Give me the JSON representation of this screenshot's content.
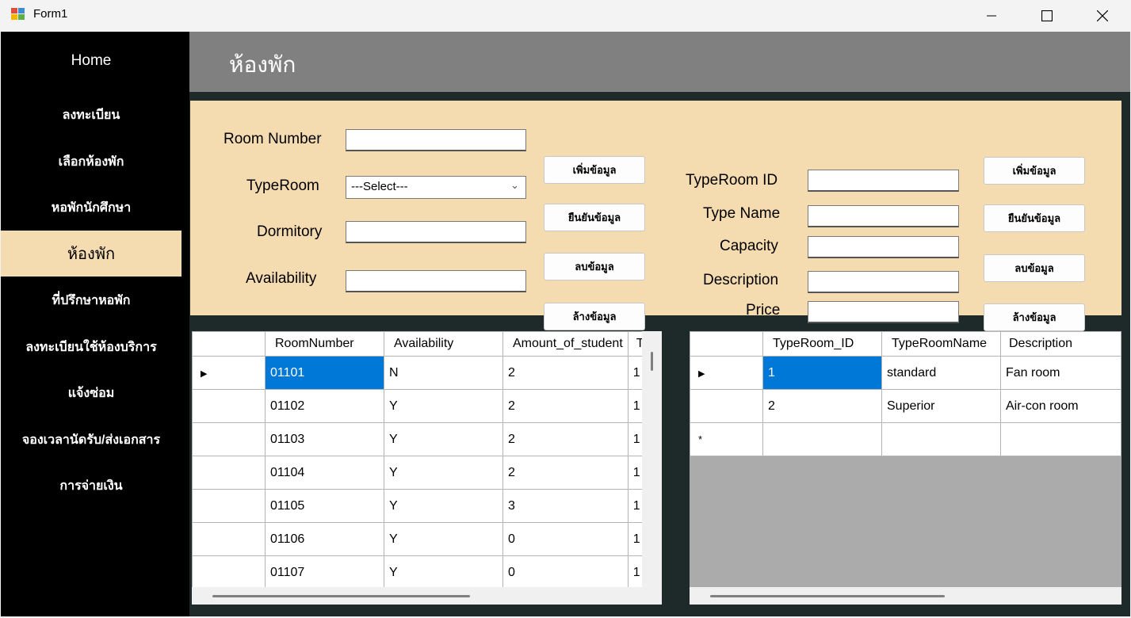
{
  "window": {
    "title": "Form1"
  },
  "sidebar": {
    "items": [
      {
        "label": "Home"
      },
      {
        "label": "ลงทะเบียน"
      },
      {
        "label": "เลือกห้องพัก"
      },
      {
        "label": "หอพักนักศึกษา"
      },
      {
        "label": "ห้องพัก"
      },
      {
        "label": "ที่ปรึกษาหอพัก"
      },
      {
        "label": "ลงทะเบียนใช้ห้องบริการ"
      },
      {
        "label": "แจ้งซ่อม"
      },
      {
        "label": "จองเวลานัดรับ/ส่งเอกสาร"
      },
      {
        "label": "การจ่ายเงิน"
      }
    ],
    "active_index": 4
  },
  "header": {
    "title": "ห้องพัก"
  },
  "room_form": {
    "room_number_label": "Room Number",
    "room_number_value": "",
    "typeroom_label": "TypeRoom",
    "typeroom_selected": "---Select---",
    "dormitory_label": "Dormitory",
    "dormitory_value": "",
    "availability_label": "Availability",
    "availability_value": "",
    "add_label": "เพิ่มข้อมูล",
    "confirm_label": "ยืนยันข้อมูล",
    "delete_label": "ลบข้อมูล",
    "clear_label": "ล้างข้อมูล"
  },
  "typeroom_form": {
    "id_label": "TypeRoom ID",
    "id_value": "",
    "name_label": "Type Name",
    "name_value": "",
    "capacity_label": "Capacity",
    "capacity_value": "",
    "description_label": "Description",
    "description_value": "",
    "price_label": "Price",
    "price_value": "",
    "add_label": "เพิ่มข้อมูล",
    "confirm_label": "ยืนยันข้อมูล",
    "delete_label": "ลบข้อมูล",
    "clear_label": "ล้างข้อมูล"
  },
  "rooms_grid": {
    "columns": [
      "RoomNumber",
      "Availability",
      "Amount_of_student",
      "Ty"
    ],
    "rows": [
      [
        "01101",
        "N",
        "2",
        "1"
      ],
      [
        "01102",
        "Y",
        "2",
        "1"
      ],
      [
        "01103",
        "Y",
        "2",
        "1"
      ],
      [
        "01104",
        "Y",
        "2",
        "1"
      ],
      [
        "01105",
        "Y",
        "3",
        "1"
      ],
      [
        "01106",
        "Y",
        "0",
        "1"
      ],
      [
        "01107",
        "Y",
        "0",
        "1"
      ]
    ],
    "current_row_marker": "▶"
  },
  "types_grid": {
    "columns": [
      "TypeRoom_ID",
      "TypeRoomName",
      "Description"
    ],
    "rows": [
      [
        "1",
        "standard",
        "Fan room"
      ],
      [
        "2",
        "Superior",
        "Air-con room"
      ]
    ],
    "current_row_marker": "▶",
    "new_row_marker": "*"
  },
  "colors": {
    "sidebar_bg": "#000000",
    "accent": "#f5dcb0",
    "header_bg": "#808080",
    "selection": "#0078d7"
  }
}
